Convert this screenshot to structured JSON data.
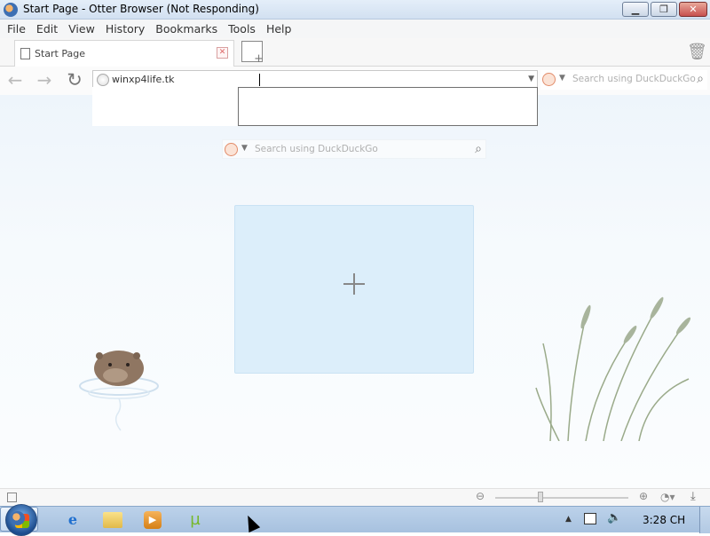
{
  "window": {
    "title": "Start Page - Otter Browser (Not Responding)"
  },
  "menu": [
    "File",
    "Edit",
    "View",
    "History",
    "Bookmarks",
    "Tools",
    "Help"
  ],
  "tab": {
    "label": "Start Page"
  },
  "address_bar": {
    "value": "winxp4life.tk"
  },
  "search": {
    "placeholder": "Search using DuckDuckGo"
  },
  "start_page": {
    "search_placeholder": "Search using DuckDuckGo"
  },
  "taskbar": {
    "clock": "3:28 CH"
  }
}
